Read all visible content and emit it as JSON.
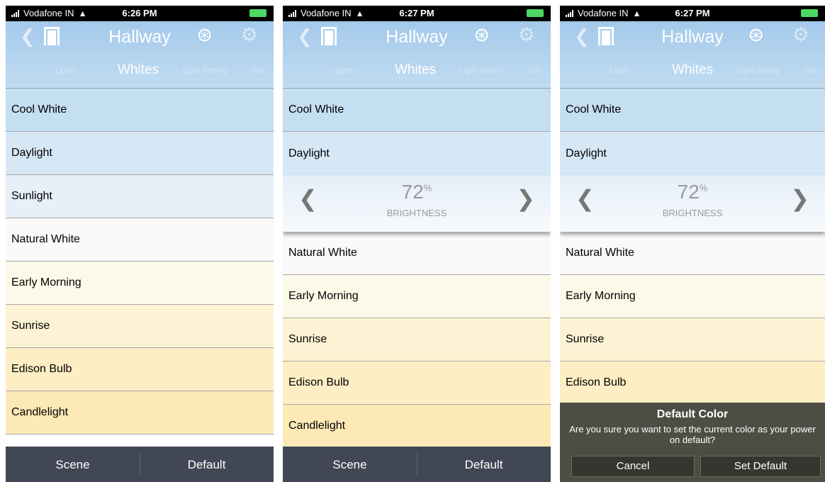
{
  "screens": [
    {
      "status": {
        "carrier": "Vodafone IN",
        "time": "6:26 PM"
      },
      "header": {
        "title": "Hallway"
      },
      "tabs": [
        "Lights",
        "Whites",
        "Light Setting",
        "Sch"
      ],
      "rows": [
        "Cool White",
        "Daylight",
        "Sunlight",
        "Natural White",
        "Early Morning",
        "Sunrise",
        "Edison Bulb",
        "Candlelight"
      ],
      "footer": {
        "scene": "Scene",
        "default": "Default"
      }
    },
    {
      "status": {
        "carrier": "Vodafone IN",
        "time": "6:27 PM"
      },
      "header": {
        "title": "Hallway"
      },
      "tabs": [
        "Lights",
        "Whites",
        "Light Setting",
        "Sch"
      ],
      "rows_top": [
        "Cool White",
        "Daylight"
      ],
      "brightness": {
        "value": "72",
        "unit": "%",
        "label": "BRIGHTNESS"
      },
      "rows_bottom": [
        "Natural White",
        "Early Morning",
        "Sunrise",
        "Edison Bulb",
        "Candlelight"
      ],
      "footer": {
        "scene": "Scene",
        "default": "Default"
      }
    },
    {
      "status": {
        "carrier": "Vodafone IN",
        "time": "6:27 PM"
      },
      "header": {
        "title": "Hallway"
      },
      "tabs": [
        "Lights",
        "Whites",
        "Light Setting",
        "Sch"
      ],
      "rows_top": [
        "Cool White",
        "Daylight"
      ],
      "brightness": {
        "value": "72",
        "unit": "%",
        "label": "BRIGHTNESS"
      },
      "rows_bottom": [
        "Natural White",
        "Early Morning",
        "Sunrise",
        "Edison Bulb"
      ],
      "dialog": {
        "title": "Default Color",
        "message": "Are you sure you want to set the current color as your power on default?",
        "cancel": "Cancel",
        "confirm": "Set Default"
      }
    }
  ],
  "icons": {
    "back": "chevron-left-icon",
    "room": "door-icon",
    "bluetooth": "bluetooth-icon",
    "settings": "gear-icon",
    "prev": "chevron-left-icon",
    "next": "chevron-right-icon"
  },
  "colors": {
    "header_top": "#a4c9eb",
    "footer": "#414754",
    "dialog": "#4e4d44",
    "warm_row": "#fdf1c6",
    "cool_row": "#c1dcf1"
  }
}
